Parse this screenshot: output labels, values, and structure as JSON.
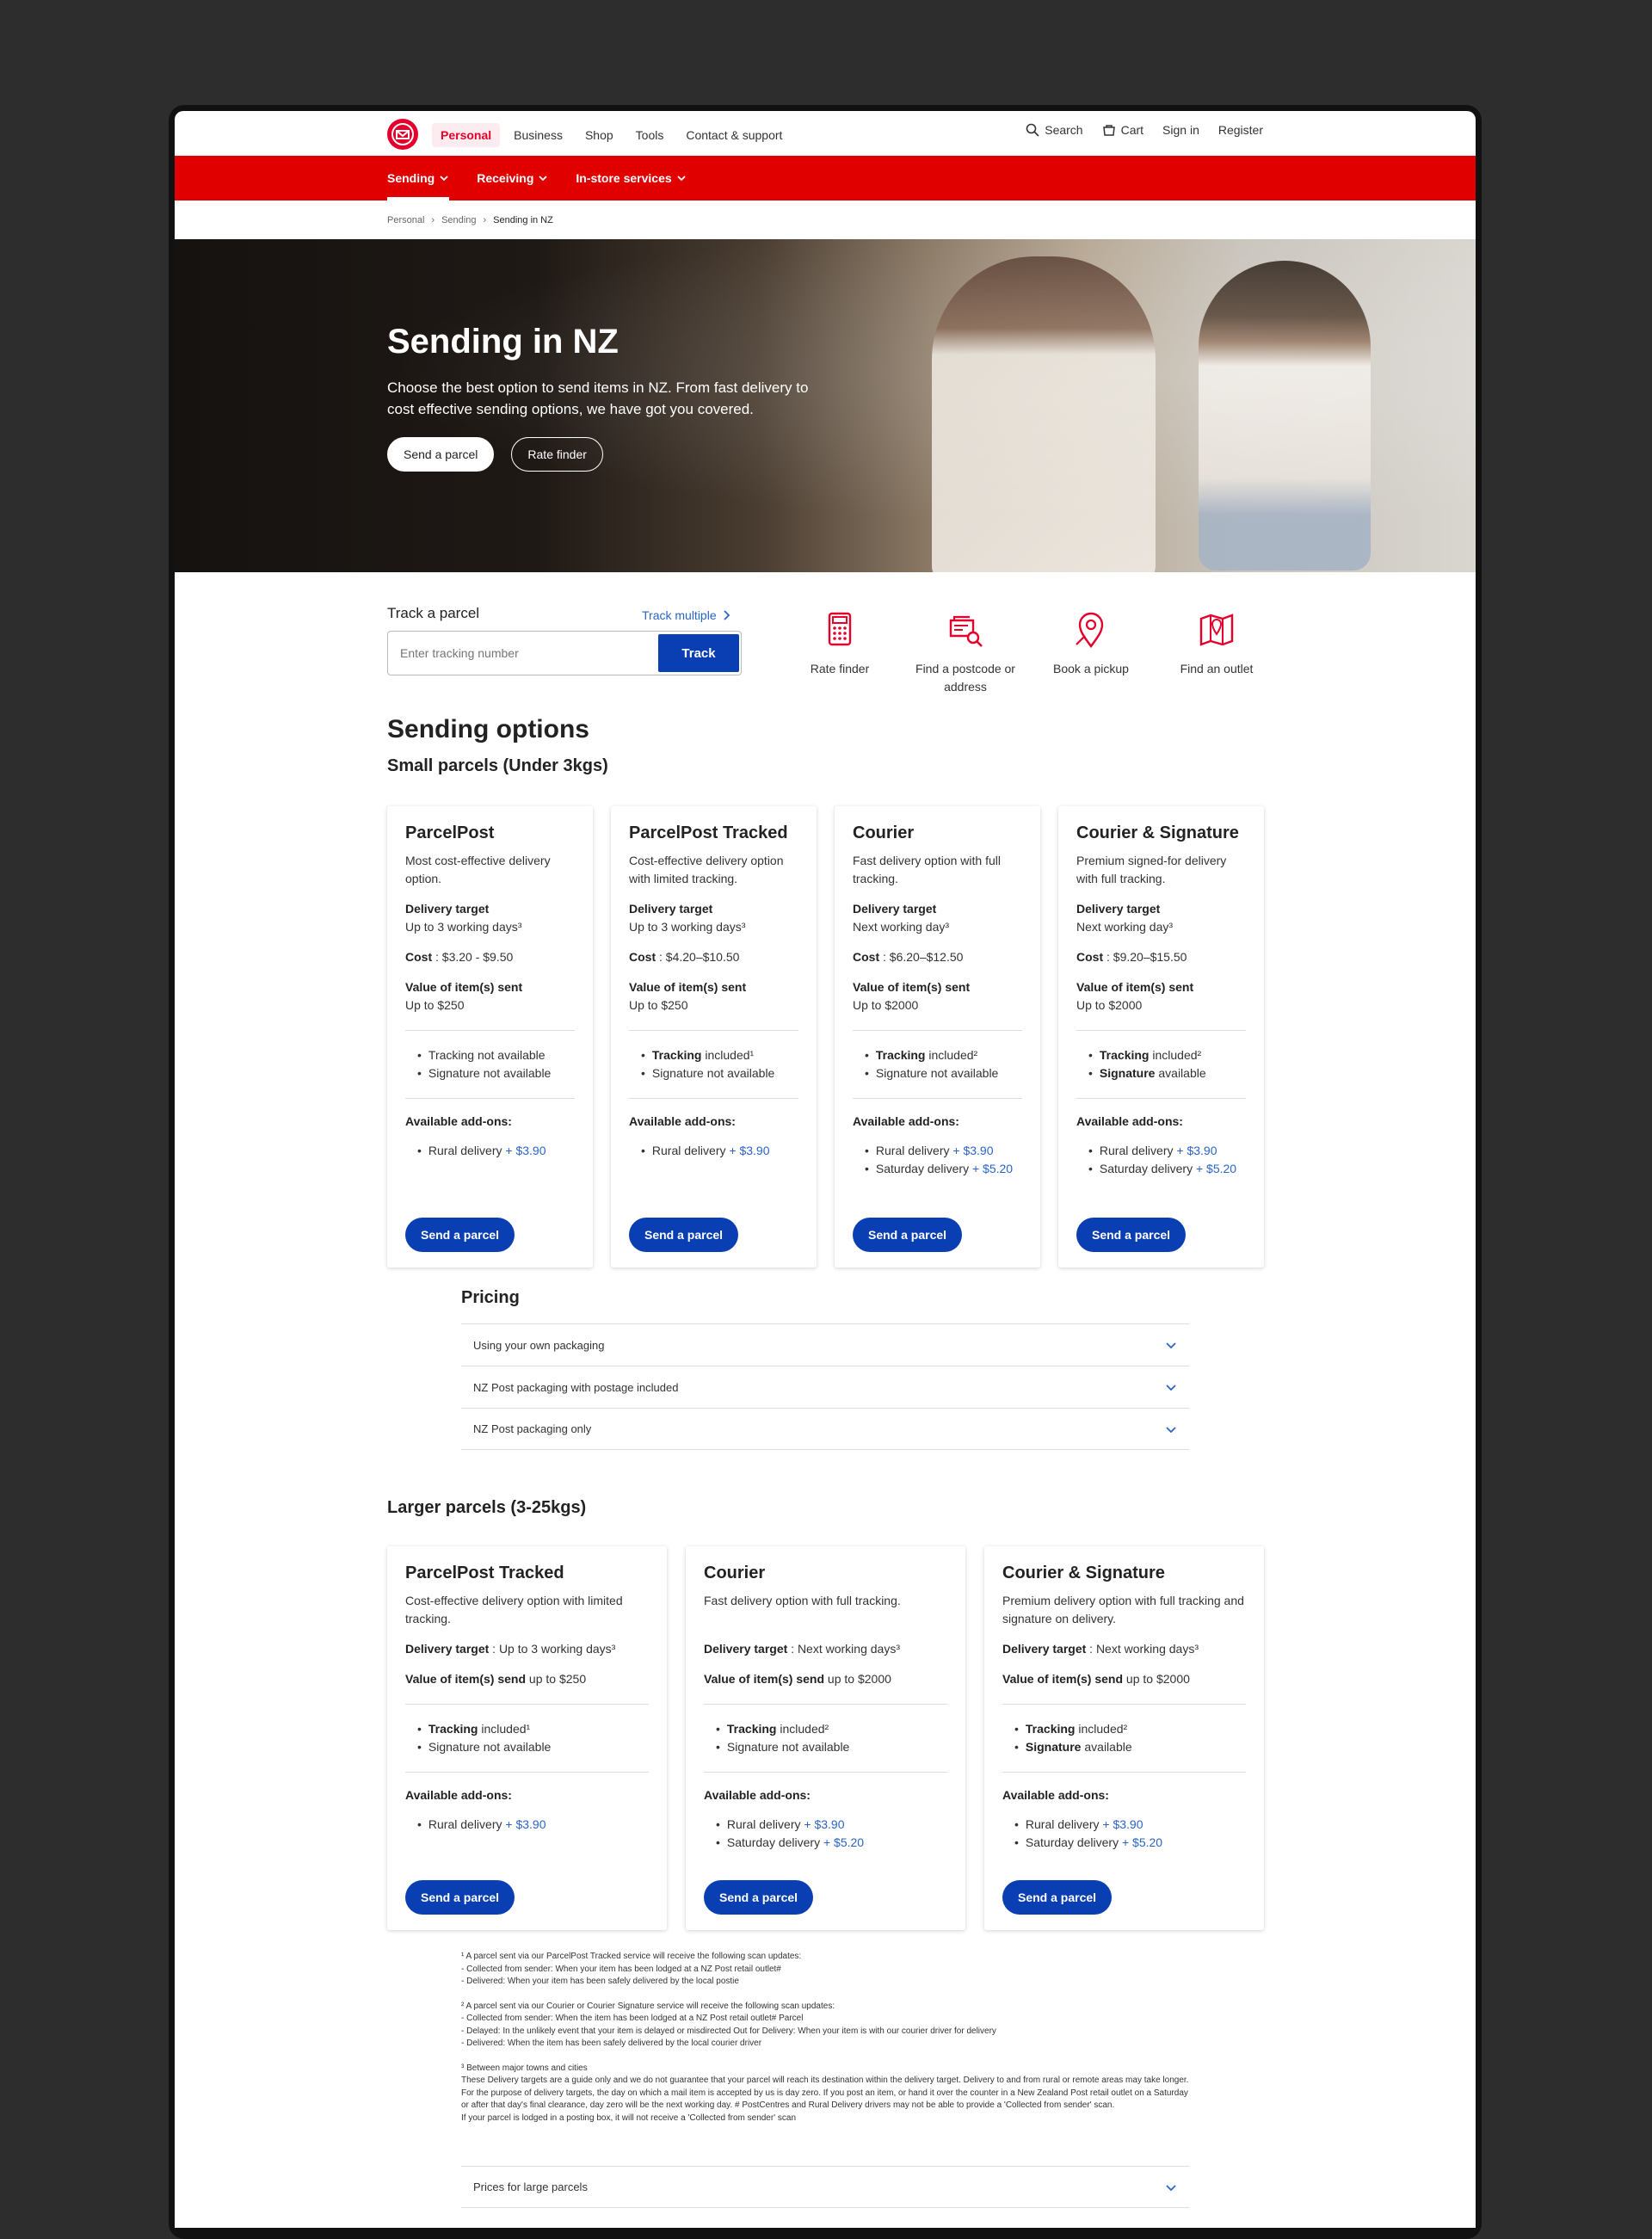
{
  "nav": {
    "items": [
      "Personal",
      "Business",
      "Shop",
      "Tools",
      "Contact & support"
    ],
    "right": {
      "search": "Search",
      "cart": "Cart",
      "signin": "Sign in",
      "register": "Register"
    }
  },
  "subnav": {
    "items": [
      "Sending",
      "Receiving",
      "In-store services"
    ]
  },
  "breadcrumb": [
    "Personal",
    "Sending",
    "Sending in NZ"
  ],
  "hero": {
    "title": "Sending in NZ",
    "subtitle": "Choose the best option to send items in NZ. From fast delivery to cost effective sending options, we have got you covered.",
    "primary": "Send a parcel",
    "secondary": "Rate finder"
  },
  "track": {
    "label": "Track a parcel",
    "multiple": "Track multiple",
    "placeholder": "Enter tracking number",
    "button": "Track"
  },
  "tools": [
    "Rate finder",
    "Find a postcode or address",
    "Book a pickup",
    "Find an outlet"
  ],
  "sending": {
    "heading": "Sending options",
    "small_heading": "Small parcels (Under 3kgs)",
    "small": [
      {
        "title": "ParcelPost",
        "desc": "Most cost-effective delivery option.",
        "target_label": "Delivery target",
        "target": "Up to 3 working days³",
        "cost_label": "Cost",
        "cost": " : $3.20 - $9.50",
        "value_label": "Value of item(s) sent",
        "value": "Up to $250",
        "f1b": "",
        "f1": "Tracking not available",
        "f2b": "",
        "f2": "Signature not available",
        "addons_label": "Available add-ons:",
        "a1": "Rural delivery ",
        "a1p": "+ $3.90",
        "a2": "",
        "a2p": "",
        "button": "Send a parcel"
      },
      {
        "title": "ParcelPost Tracked",
        "desc": "Cost-effective delivery option with limited tracking.",
        "target_label": "Delivery target",
        "target": "Up to 3 working days³",
        "cost_label": "Cost",
        "cost": " : $4.20–$10.50",
        "value_label": "Value of item(s) sent",
        "value": "Up to $250",
        "f1b": "Tracking",
        "f1": " included¹",
        "f2b": "",
        "f2": "Signature not available",
        "addons_label": "Available add-ons:",
        "a1": "Rural delivery ",
        "a1p": "+ $3.90",
        "a2": "",
        "a2p": "",
        "button": "Send a parcel"
      },
      {
        "title": "Courier",
        "desc": "Fast delivery option with full tracking.",
        "target_label": "Delivery target",
        "target": "Next working day³",
        "cost_label": "Cost",
        "cost": " : $6.20–$12.50",
        "value_label": "Value of item(s) sent",
        "value": "Up to $2000",
        "f1b": "Tracking",
        "f1": " included²",
        "f2b": "",
        "f2": "Signature not available",
        "addons_label": "Available add-ons:",
        "a1": "Rural delivery ",
        "a1p": "+ $3.90",
        "a2": "Saturday delivery ",
        "a2p": "+ $5.20",
        "button": "Send a parcel"
      },
      {
        "title": "Courier & Signature",
        "desc": "Premium signed-for delivery with full tracking.",
        "target_label": "Delivery target",
        "target": "Next working day³",
        "cost_label": "Cost",
        "cost": " : $9.20–$15.50",
        "value_label": "Value of item(s) sent",
        "value": "Up to $2000",
        "f1b": "Tracking",
        "f1": " included²",
        "f2b": "Signature",
        "f2": " available",
        "addons_label": "Available add-ons:",
        "a1": "Rural delivery ",
        "a1p": "+ $3.90",
        "a2": "Saturday delivery ",
        "a2p": "+ $5.20",
        "button": "Send a parcel"
      }
    ],
    "pricing_heading": "Pricing",
    "pricing": [
      "Using your own packaging",
      "NZ Post packaging with postage included",
      "NZ Post packaging only"
    ],
    "large_heading": "Larger parcels (3-25kgs)",
    "large": [
      {
        "title": "ParcelPost Tracked",
        "desc": "Cost-effective delivery option with limited tracking.",
        "target_label": "Delivery target",
        "target": " : Up to 3 working days³",
        "value_label": "Value of item(s) send",
        "value": " up to $250",
        "f1b": "Tracking",
        "f1": " included¹",
        "f2b": "",
        "f2": "Signature not available",
        "addons_label": "Available add-ons:",
        "a1": "Rural delivery ",
        "a1p": "+ $3.90",
        "a2": "",
        "a2p": "",
        "button": "Send a parcel"
      },
      {
        "title": "Courier",
        "desc": "Fast delivery option with full tracking.",
        "target_label": "Delivery target",
        "target": " : Next working days³",
        "value_label": "Value of item(s) send",
        "value": " up to $2000",
        "f1b": "Tracking",
        "f1": " included²",
        "f2b": "",
        "f2": "Signature not available",
        "addons_label": "Available add-ons:",
        "a1": "Rural delivery ",
        "a1p": "+ $3.90",
        "a2": "Saturday delivery ",
        "a2p": "+ $5.20",
        "button": "Send a parcel"
      },
      {
        "title": "Courier & Signature",
        "desc": "Premium delivery option with full tracking and signature on delivery.",
        "target_label": "Delivery target",
        "target": " : Next working days³",
        "value_label": "Value of item(s) send",
        "value": " up to $2000",
        "f1b": "Tracking",
        "f1": " included²",
        "f2b": "Signature",
        "f2": " available",
        "addons_label": "Available add-ons:",
        "a1": "Rural delivery ",
        "a1p": "+ $3.90",
        "a2": "Saturday delivery ",
        "a2p": "+ $5.20",
        "button": "Send a parcel"
      }
    ]
  },
  "footnotes": [
    "¹ A parcel sent via our ParcelPost Tracked service will receive the following scan updates:\n- Collected from sender: When your item has been lodged at a NZ Post retail outlet#\n- Delivered: When your item has been safely delivered by the local postie",
    "² A parcel sent via our Courier or Courier Signature service will receive the following scan updates:\n- Collected from sender: When the item has been lodged at a NZ Post retail outlet# Parcel\n- Delayed: In the unlikely event that your item is delayed or misdirected Out for Delivery: When your item is with our courier driver for delivery\n- Delivered: When the item has been safely delivered by the local courier driver",
    "³ Between major towns and cities\nThese Delivery targets are a guide only and we do not guarantee that your parcel will reach its destination within the delivery target. Delivery to and from rural or remote areas may take longer. For the purpose of delivery targets, the day on which a mail item is accepted by us is day zero. If you post an item, or hand it over the counter in a New Zealand Post retail outlet on a Saturday or after that day's final clearance, day zero will be the next working day. # PostCentres and Rural Delivery drivers may not be able to provide a 'Collected from sender' scan.\nIf your parcel is lodged in a posting box, it will not receive a 'Collected from sender' scan"
  ],
  "large_prices": "Prices for large parcels",
  "colors": {
    "brand_red": "#e00000",
    "primary_blue": "#0a3fb3",
    "link_blue": "#2a64c6"
  }
}
